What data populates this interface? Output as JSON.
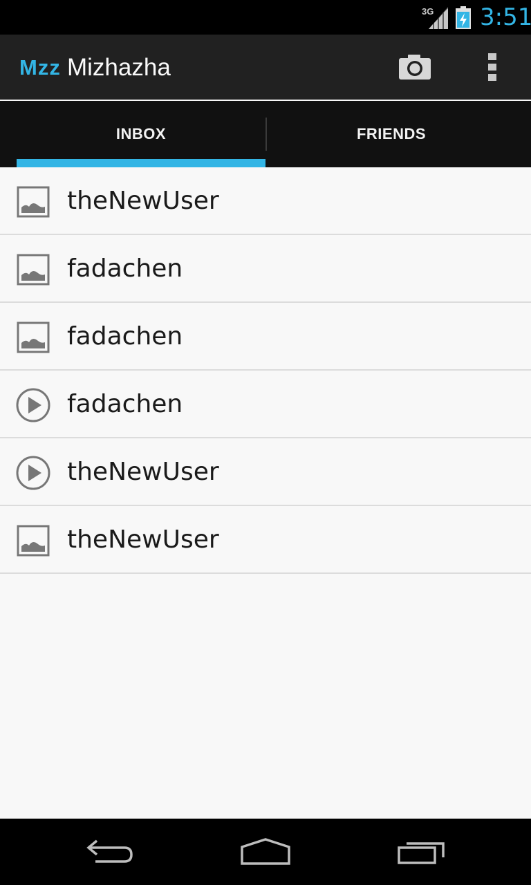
{
  "status_bar": {
    "network": "3G",
    "time": "3:51",
    "icons": [
      "signal-icon",
      "battery-charging-icon"
    ],
    "accent_color": "#33b5e5"
  },
  "action_bar": {
    "logo": "Mzz",
    "title": "Mizhazha",
    "actions": [
      "camera-icon",
      "overflow-menu-icon"
    ]
  },
  "tabs": [
    {
      "label": "INBOX",
      "selected": true
    },
    {
      "label": "FRIENDS",
      "selected": false
    }
  ],
  "messages": [
    {
      "sender": "theNewUser",
      "type": "image",
      "icon": "image-icon"
    },
    {
      "sender": "fadachen",
      "type": "image",
      "icon": "image-icon"
    },
    {
      "sender": "fadachen",
      "type": "image",
      "icon": "image-icon"
    },
    {
      "sender": "fadachen",
      "type": "video",
      "icon": "play-icon"
    },
    {
      "sender": "theNewUser",
      "type": "video",
      "icon": "play-icon"
    },
    {
      "sender": "theNewUser",
      "type": "image",
      "icon": "image-icon"
    }
  ],
  "nav_bar": {
    "buttons": [
      "back-icon",
      "home-icon",
      "recents-icon"
    ]
  }
}
